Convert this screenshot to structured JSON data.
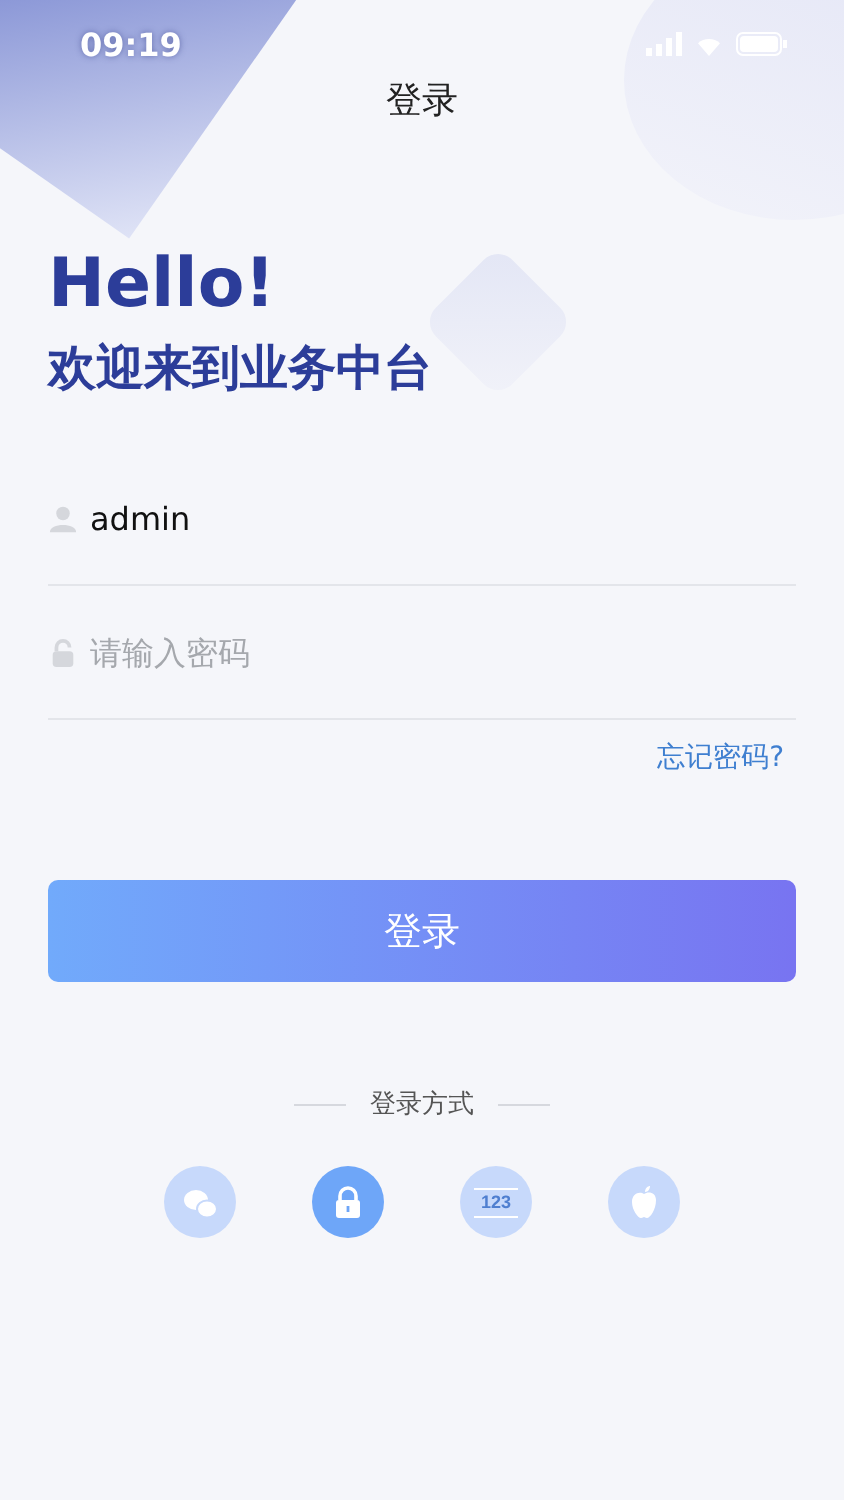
{
  "status_bar": {
    "time": "09:19"
  },
  "nav": {
    "title": "登录"
  },
  "greeting": {
    "title": "Hello!",
    "subtitle": "欢迎来到业务中台"
  },
  "fields": [
    {
      "kind": "user",
      "value": "admin"
    },
    {
      "kind": "password",
      "placeholder": "请输入密码"
    }
  ],
  "forgot_link": "忘记密码?",
  "login_button": "登录",
  "methods_label": "登录方式",
  "methods": [
    {
      "kind": "wechat",
      "selected": false
    },
    {
      "kind": "password",
      "selected": true
    },
    {
      "kind": "code",
      "label": "123",
      "selected": false
    },
    {
      "kind": "apple",
      "selected": false
    }
  ]
}
